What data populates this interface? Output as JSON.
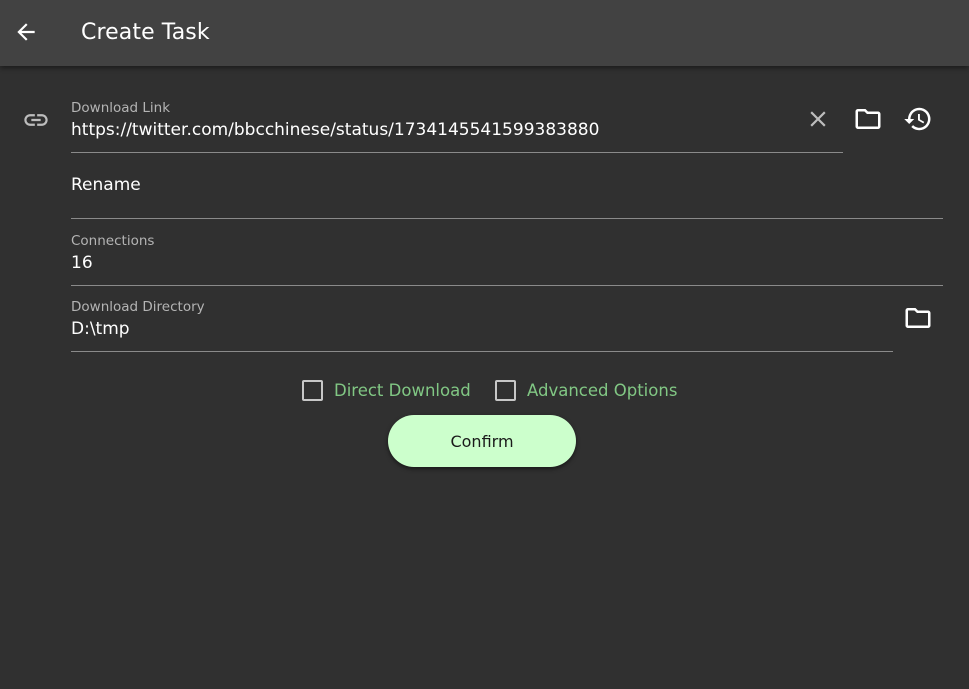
{
  "header": {
    "title": "Create Task",
    "back_icon": "arrow-back-icon"
  },
  "form": {
    "download_link": {
      "label": "Download Link",
      "value": "https://twitter.com/bbcchinese/status/1734145541599383880",
      "leading_icon": "link-icon",
      "actions": [
        "close-icon",
        "folder-icon",
        "history-icon"
      ]
    },
    "rename": {
      "placeholder": "Rename",
      "value": ""
    },
    "connections": {
      "label": "Connections",
      "value": "16"
    },
    "download_directory": {
      "label": "Download Directory",
      "value": "D:\\tmp",
      "action": "folder-icon"
    }
  },
  "options": {
    "direct_download": {
      "label": "Direct Download",
      "checked": false
    },
    "advanced_options": {
      "label": "Advanced Options",
      "checked": false
    }
  },
  "actions": {
    "confirm_label": "Confirm"
  },
  "colors": {
    "background": "#303030",
    "app_bar": "#424242",
    "accent_text": "#81c784",
    "confirm_button": "#ccffcc"
  }
}
